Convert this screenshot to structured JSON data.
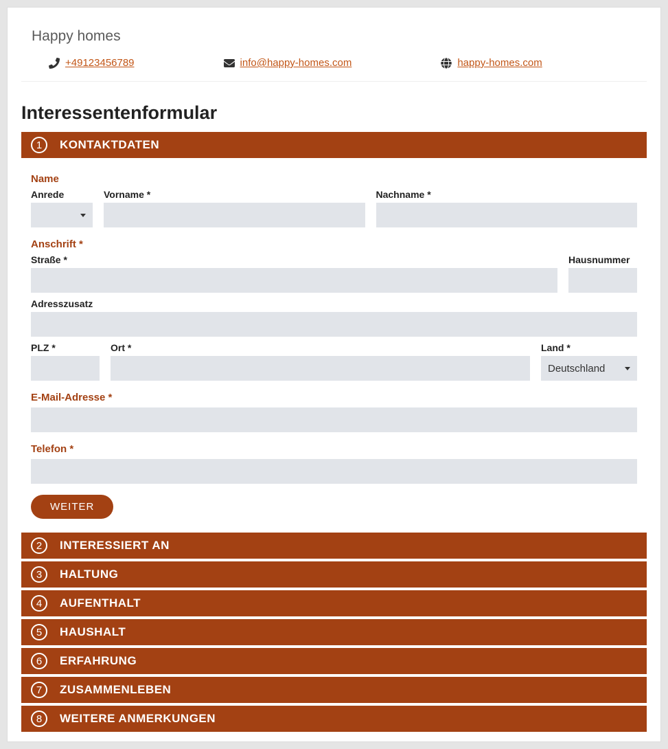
{
  "header": {
    "org_name": "Happy homes",
    "phone": "+49123456789",
    "email": "info@happy-homes.com",
    "website": "happy-homes.com"
  },
  "form": {
    "title": "Interessentenformular",
    "sections": [
      {
        "num": "1",
        "label": "KONTAKTDATEN"
      },
      {
        "num": "2",
        "label": "INTERESSIERT AN"
      },
      {
        "num": "3",
        "label": "HALTUNG"
      },
      {
        "num": "4",
        "label": "AUFENTHALT"
      },
      {
        "num": "5",
        "label": "HAUSHALT"
      },
      {
        "num": "6",
        "label": "ERFAHRUNG"
      },
      {
        "num": "7",
        "label": "ZUSAMMENLEBEN"
      },
      {
        "num": "8",
        "label": "WEITERE ANMERKUNGEN"
      }
    ],
    "kontakt": {
      "name_heading": "Name",
      "anrede_label": "Anrede",
      "vorname_label": "Vorname  *",
      "nachname_label": "Nachname  *",
      "anschrift_heading": "Anschrift  *",
      "strasse_label": "Straße  *",
      "hausnummer_label": "Hausnummer",
      "adresszusatz_label": "Adresszusatz",
      "plz_label": "PLZ  *",
      "ort_label": "Ort  *",
      "land_label": "Land  *",
      "land_value": "Deutschland",
      "email_heading": "E-Mail-Adresse  *",
      "telefon_heading": "Telefon  *",
      "next_button": "WEITER"
    }
  }
}
